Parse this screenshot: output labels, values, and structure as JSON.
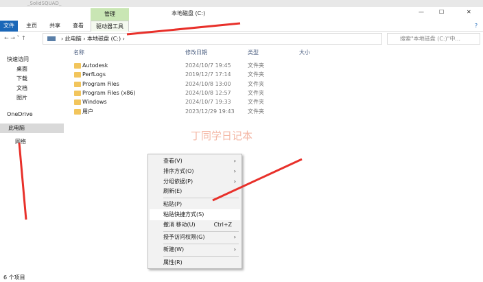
{
  "top_title": "_SolidSQUAD_",
  "window": {
    "title": "本地磁盘 (C:)",
    "manage_tab": "管理",
    "min": "—",
    "max": "☐",
    "close": "✕",
    "help": "?"
  },
  "ribbon": {
    "tabs": [
      "文件",
      "主页",
      "共享",
      "查看",
      "驱动器工具"
    ]
  },
  "address": {
    "crumbs": [
      "此电脑",
      "本地磁盘 (C:)"
    ],
    "sep": "›",
    "search_placeholder": "搜索\"本地磁盘 (C:)\"中..."
  },
  "columns": [
    "名称",
    "修改日期",
    "类型",
    "大小"
  ],
  "sidebar": [
    "快速访问",
    "桌面",
    "下载",
    "文档",
    "图片",
    "OneDrive",
    "此电脑",
    "网络"
  ],
  "files": [
    {
      "name": "Autodesk",
      "date": "2024/10/7 19:45",
      "type": "文件夹"
    },
    {
      "name": "PerfLogs",
      "date": "2019/12/7 17:14",
      "type": "文件夹"
    },
    {
      "name": "Program Files",
      "date": "2024/10/8 13:00",
      "type": "文件夹"
    },
    {
      "name": "Program Files (x86)",
      "date": "2024/10/8 12:57",
      "type": "文件夹"
    },
    {
      "name": "Windows",
      "date": "2024/10/7 19:33",
      "type": "文件夹"
    },
    {
      "name": "用户",
      "date": "2023/12/29 19:43",
      "type": "文件夹"
    }
  ],
  "menu": {
    "items": [
      "查看(V)",
      "排序方式(O)",
      "分组依据(P)",
      "刷新(E)",
      "粘贴(P)",
      "粘贴快捷方式(S)",
      "撤消 移动(U)",
      "授予访问权限(G)",
      "新建(W)",
      "属性(R)"
    ],
    "shortcut": "Ctrl+Z",
    "arrow": "›"
  },
  "watermark": "丁同学日记本",
  "status": "6 个项目"
}
